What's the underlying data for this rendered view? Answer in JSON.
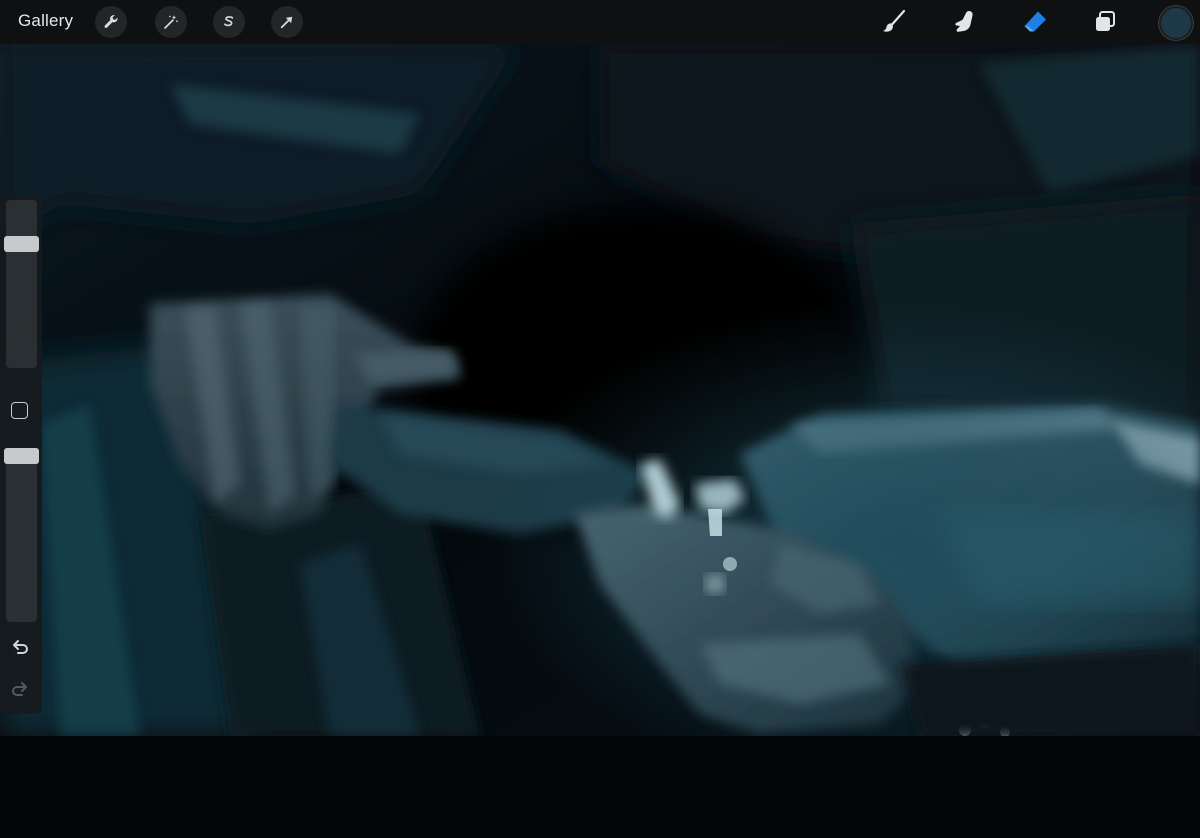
{
  "toolbar": {
    "gallery_label": "Gallery",
    "left_tools": [
      {
        "name": "actions",
        "icon": "wrench-icon"
      },
      {
        "name": "adjustments",
        "icon": "magic-wand-icon"
      },
      {
        "name": "selection",
        "icon": "selection-s-icon"
      },
      {
        "name": "transform",
        "icon": "arrow-cursor-icon"
      }
    ],
    "right_tools": [
      {
        "name": "brush",
        "icon": "brush-icon"
      },
      {
        "name": "smudge",
        "icon": "smudge-finger-icon"
      },
      {
        "name": "eraser",
        "icon": "eraser-icon",
        "active": true
      },
      {
        "name": "layers",
        "icon": "layers-icon"
      }
    ],
    "active_tool_color": "#1f7fe5",
    "current_color": "#1d3846"
  },
  "sidebar": {
    "brush_size_level": 0.76,
    "brush_opacity_level": 1.0,
    "modify_icon": "square-icon",
    "undo_icon": "undo-icon",
    "redo_icon": "redo-icon"
  },
  "canvas": {
    "palette": {
      "background": "#050b10",
      "shadow": "#07131a",
      "mid": "#1a3542",
      "teal": "#2a5665",
      "highlight": "#6b8e9a",
      "bright": "#b8d4dc"
    }
  }
}
